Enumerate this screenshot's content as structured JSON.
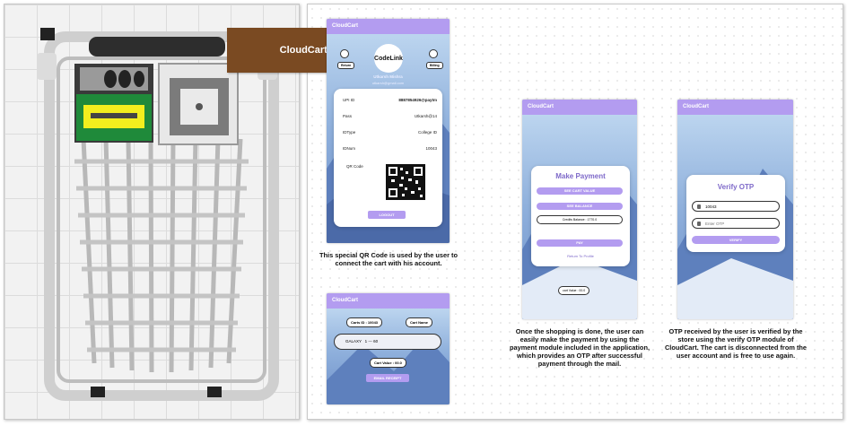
{
  "app_name": "CloudCart",
  "title": "CloudCart Application",
  "profile": {
    "logo_text": "CodeLink",
    "return_label": "Return",
    "billing_label": "Billing",
    "name": "Utkarsh Mishra",
    "email": "utkarsh@gmail.com",
    "rows": [
      {
        "label": "UPI ID",
        "value": "8887854926@paytm"
      },
      {
        "label": "Pass",
        "value": "Utkarsh@14"
      },
      {
        "label": "IDType",
        "value": "College ID"
      },
      {
        "label": "IDNum",
        "value": "10043"
      }
    ],
    "qr_label": "QR Code",
    "logout_label": "LOGOUT"
  },
  "cart": {
    "cart_id": "Carts ID : 10043",
    "cart_name": "Cart Name",
    "galaxy": "GALAXY   1 --- 60",
    "cart_value": "Cart Value : 00.0",
    "email_receipt": "EMAIL RECEIPT"
  },
  "payment": {
    "heading": "Make Payment",
    "see_cart_value": "SEE CART VALUE",
    "see_balance": "SEE BALANCE",
    "balance_text": "Credits Balance : 1770.0",
    "pay": "PAY",
    "return_link": "Return To Profile",
    "cart_value_badge": "cart Value : 00.0"
  },
  "otp": {
    "heading": "Verify OTP",
    "id_value": "10043",
    "otp_placeholder": "Enter OTP",
    "verify": "VERIFY"
  },
  "captions": {
    "qr": "This special QR Code is used by the user to connect the cart with his account.",
    "payment": "Once the shopping is done, the user can easily make the  payment by using the payment module included in the application, which provides an OTP after successful payment through the mail.",
    "otp": "OTP received by the user is verified by the store using the verify OTP module of CloudCart. The cart is disconnected from the user account and is free to use again."
  },
  "colors": {
    "header": "#b39cf0",
    "title_bg": "#7a4a22",
    "lcd": "#f2ee1e"
  }
}
